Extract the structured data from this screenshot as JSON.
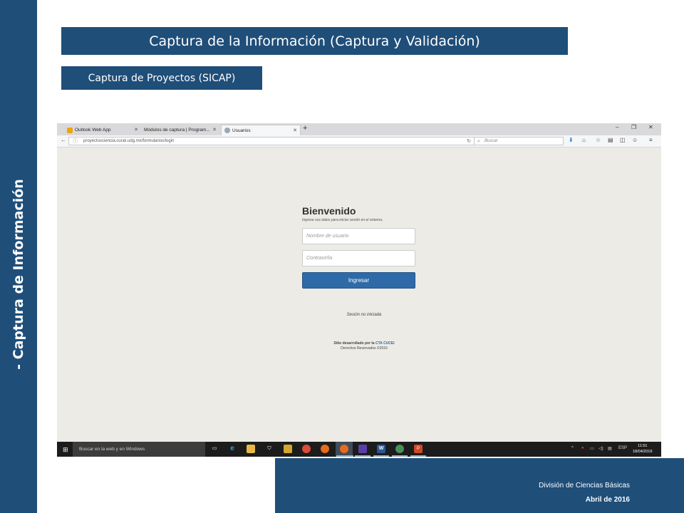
{
  "sidebar": {
    "title": "- Captura de Información"
  },
  "header": {
    "title": "Captura de la Información (Captura y Validación)",
    "subtitle": "Captura de Proyectos (SICAP)"
  },
  "footer": {
    "division": "División  de  Ciencias  Básicas",
    "date": "Abril de 2016"
  },
  "browser": {
    "tabs": [
      {
        "label": "Outlook Web App",
        "close": "✕"
      },
      {
        "label": "Módulos de captura | Program...",
        "close": "✕"
      },
      {
        "label": "Usuarios",
        "close": "✕",
        "active": true
      }
    ],
    "new_tab": "+",
    "window_controls": {
      "minimize": "–",
      "maximize": "❐",
      "close": "✕"
    },
    "url": "proyectosciencia.cucei.udg.mx/formularios/login",
    "search_placeholder": "Buscar"
  },
  "login": {
    "heading": "Bienvenido",
    "lead": "Ingrese sus datos para iniciar sesión en el sistema.",
    "username_placeholder": "Nombre de usuario",
    "password_placeholder": "Contraseña",
    "submit_label": "Ingresar",
    "status": "Sesión no iniciada",
    "credit_prefix": "Sitio desarrollado por la",
    "credit_link": "CTA CUCEI",
    "rights": "Derechos Reservados ©2016"
  },
  "taskbar": {
    "search_placeholder": "Buscar en la web y en Windows",
    "language": "ESP",
    "time": "11:51",
    "date": "18/04/2016"
  },
  "colors": {
    "slide_blue": "#1f4e79",
    "button_blue": "#2e6aa8",
    "page_bg": "#ecebe6"
  }
}
